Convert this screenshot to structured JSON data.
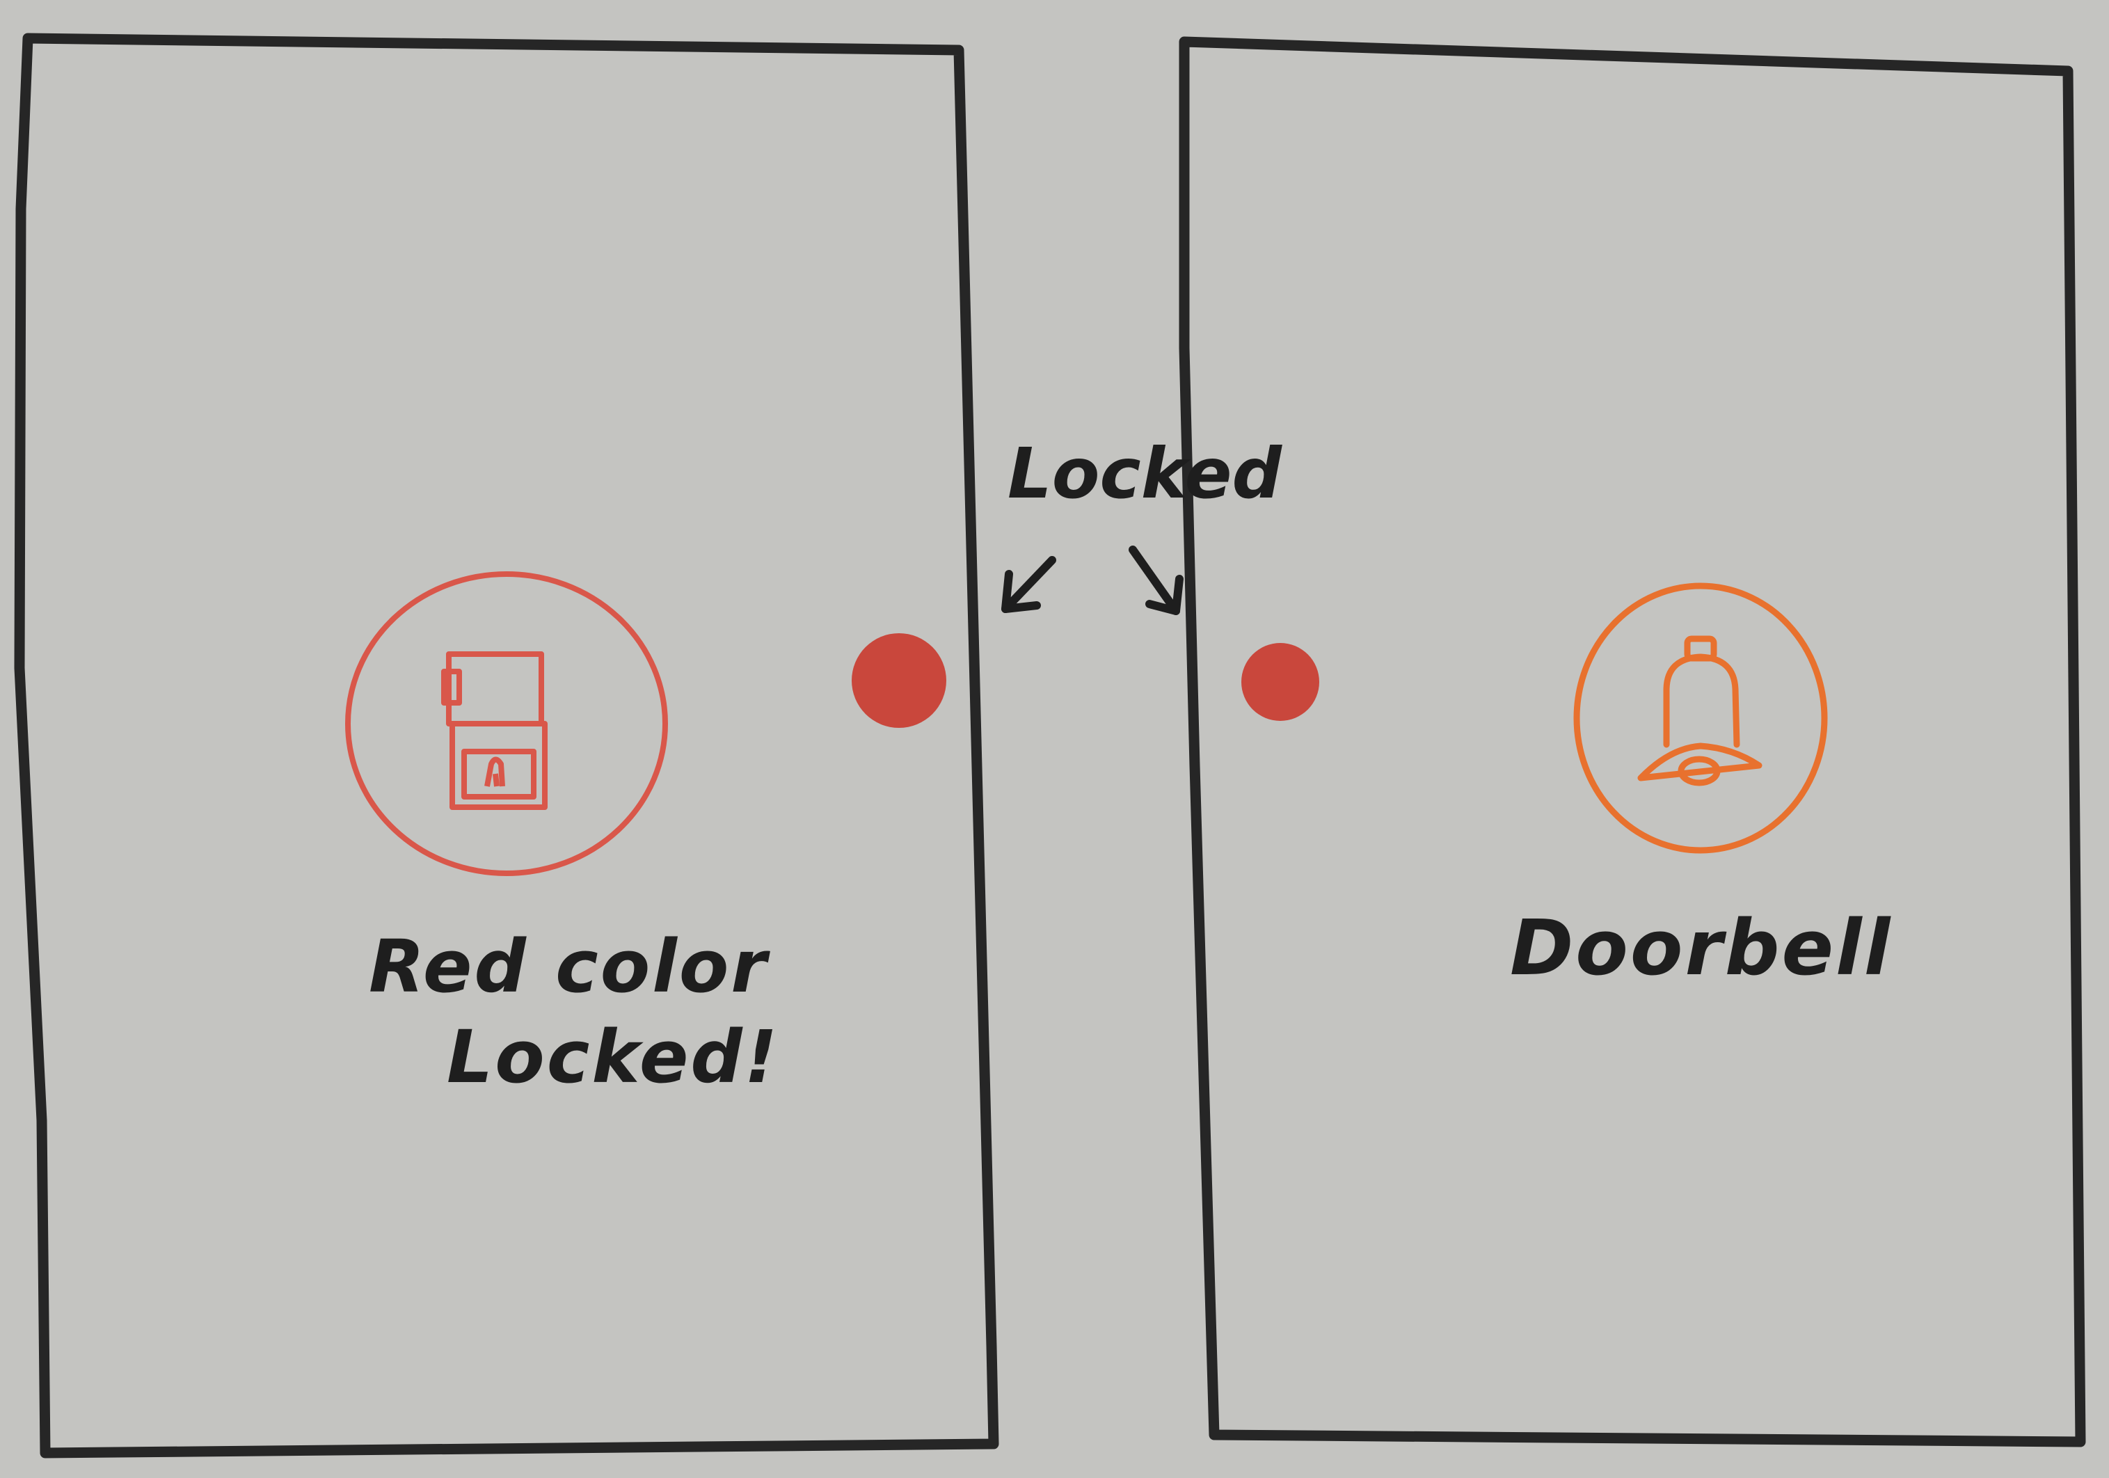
{
  "annotation": {
    "label": "Locked"
  },
  "left_screen": {
    "icon": "door-lock-icon",
    "caption_lines": [
      "Red color",
      "Locked!"
    ]
  },
  "right_screen": {
    "icon": "bell-icon",
    "caption": "Doorbell"
  },
  "colors": {
    "paper": "#c4c4c1",
    "ink": "#1e1e1e",
    "lock_red": "#d9574a",
    "bell_orange": "#e8712e",
    "status_dot": "#c9473c"
  }
}
